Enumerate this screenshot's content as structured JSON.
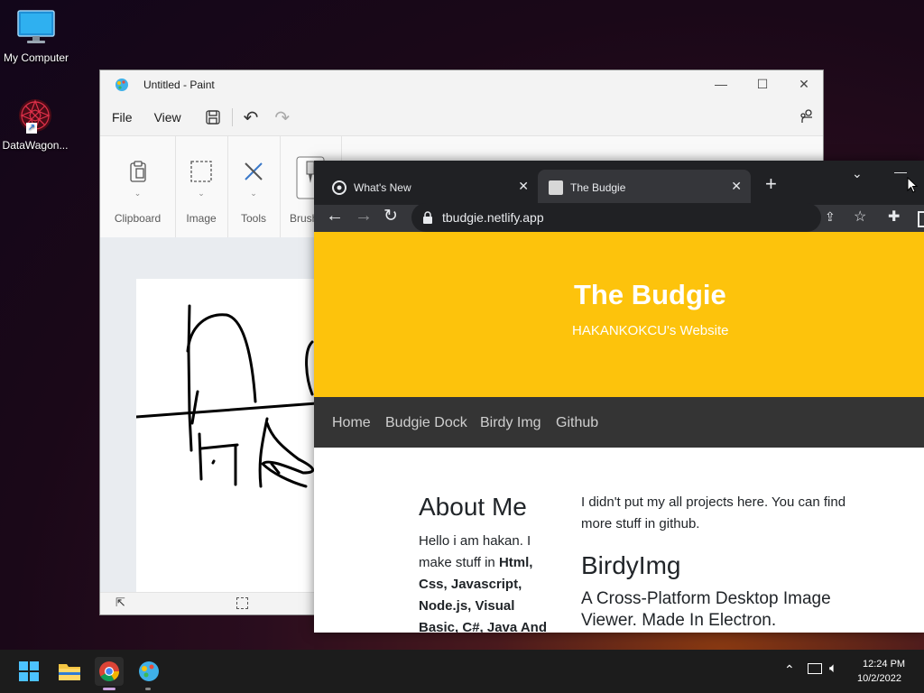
{
  "desktop": {
    "icons": [
      {
        "label": "My Computer"
      },
      {
        "label": "DataWagon..."
      }
    ]
  },
  "paint": {
    "title": "Untitled - Paint",
    "menu": {
      "file": "File",
      "view": "View"
    },
    "ribbon": {
      "clipboard": "Clipboard",
      "image": "Image",
      "tools": "Tools",
      "brushes": "Brush"
    }
  },
  "chrome": {
    "tabs": [
      {
        "title": "What's New"
      },
      {
        "title": "The Budgie"
      }
    ],
    "url": "tbudgie.netlify.app",
    "page": {
      "title": "The Budgie",
      "subtitle": "HAKANKOKCU's Website",
      "nav": [
        "Home",
        "Budgie Dock",
        "Birdy Img",
        "Github"
      ],
      "about_heading": "About Me",
      "about_text_plain": "Hello i am hakan. I make stuff in",
      "about_text_bold": "Html, Css, Javascript, Node.js, Visual Basic, C#, Java And",
      "intro": "I didn't put my all projects here. You can find more stuff in github.",
      "project_heading": "BirdyImg",
      "project_sub": "A Cross-Platform Desktop Image Viewer. Made In Electron."
    }
  },
  "taskbar": {
    "time": "12:24 PM",
    "date": "10/2/2022"
  }
}
